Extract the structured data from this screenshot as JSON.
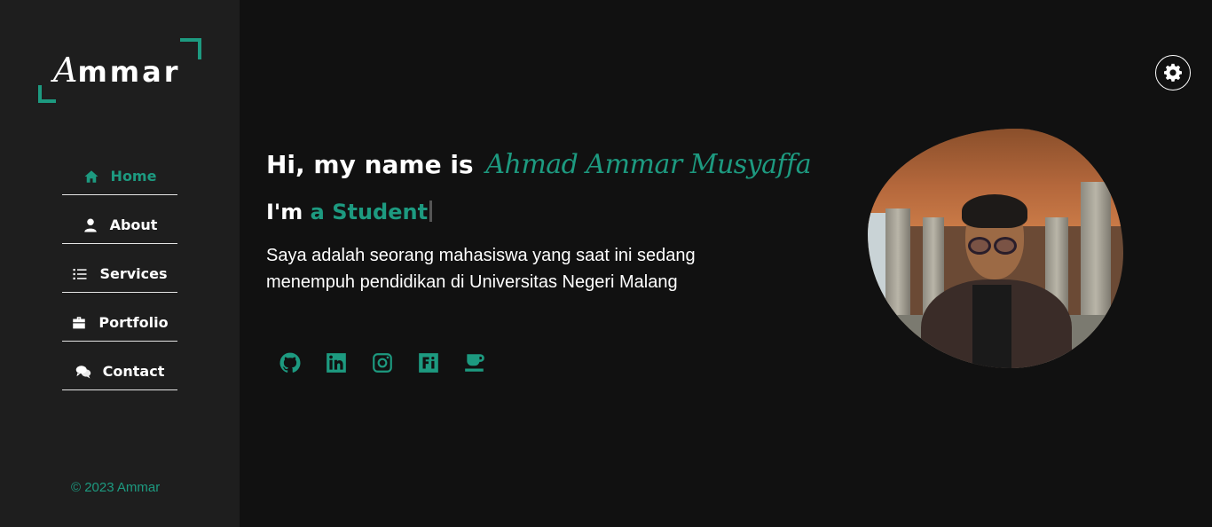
{
  "sidebar": {
    "logo": {
      "first_letter": "A",
      "rest": "mmar"
    },
    "nav": [
      {
        "label": "Home",
        "icon": "home-icon",
        "active": true
      },
      {
        "label": "About",
        "icon": "user-icon",
        "active": false
      },
      {
        "label": "Services",
        "icon": "list-icon",
        "active": false
      },
      {
        "label": "Portfolio",
        "icon": "briefcase-icon",
        "active": false
      },
      {
        "label": "Contact",
        "icon": "comments-icon",
        "active": false
      }
    ],
    "copyright": "© 2023 Ammar"
  },
  "header": {
    "settings_icon": "gear-icon"
  },
  "hero": {
    "greeting": "Hi, my name is",
    "name": "Ahmad Ammar Musyaffa",
    "role_prefix": "I'm",
    "role_typed": "a Student",
    "description": "Saya adalah seorang mahasiswa yang saat ini sedang menempuh pendidikan di Universitas Negeri Malang"
  },
  "socials": [
    {
      "icon": "github-icon"
    },
    {
      "icon": "linkedin-icon"
    },
    {
      "icon": "instagram-icon"
    },
    {
      "icon": "fastwork-icon"
    },
    {
      "icon": "coffee-icon"
    }
  ],
  "colors": {
    "accent": "#1d9a80",
    "sidebar_bg": "#1e1e1e",
    "page_bg": "#111111"
  }
}
